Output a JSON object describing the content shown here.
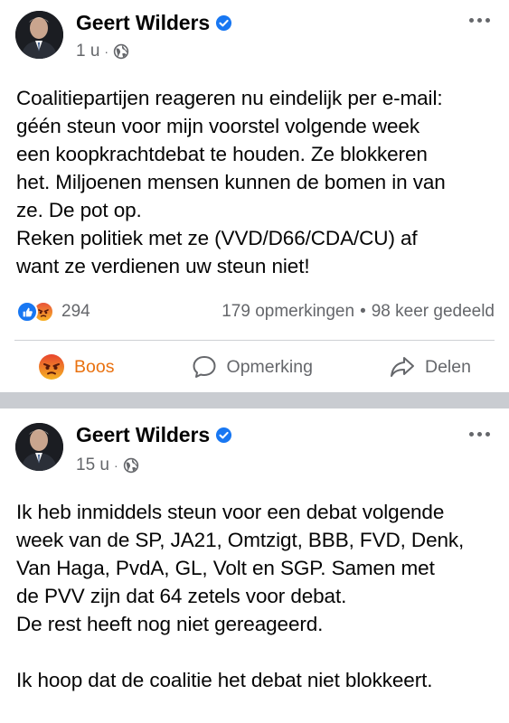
{
  "posts": [
    {
      "author": "Geert Wilders",
      "time": "1 u",
      "text_lines": [
        "Coalitiepartijen reageren nu eindelijk per e-mail:",
        "géén steun voor mijn voorstel volgende week",
        "een koopkrachtdebat te houden. Ze blokkeren",
        "het. Miljoenen mensen kunnen de bomen in van",
        "ze. De pot op.",
        "Reken politiek met ze (VVD/D66/CDA/CU) af",
        "want ze verdienen uw steun niet!"
      ],
      "reaction_count": "294",
      "comments": "179 opmerkingen",
      "stats_separator": "•",
      "shares": "98 keer gedeeld",
      "actions": {
        "react_label": "Boos",
        "comment_label": "Opmerking",
        "share_label": "Delen"
      }
    },
    {
      "author": "Geert Wilders",
      "time": "15 u",
      "text_lines": [
        "Ik heb inmiddels steun voor een debat volgende",
        "week van de SP, JA21, Omtzigt, BBB, FVD, Denk,",
        "Van Haga, PvdA, GL, Volt en SGP. Samen met",
        "de PVV zijn dat 64 zetels voor debat.",
        "De rest heeft nog niet gereageerd.",
        "",
        "Ik hoop dat de coalitie het debat niet blokkeert."
      ]
    }
  ],
  "meta_separator": "·",
  "icons": {
    "verified": "verified-badge-icon",
    "privacy": "globe-icon",
    "more": "more-options-icon",
    "like": "like-reaction-icon",
    "angry": "angry-reaction-icon",
    "comment": "comment-bubble-icon",
    "share": "share-arrow-icon"
  },
  "colors": {
    "verified_blue": "#1877f2",
    "secondary_text": "#65676b",
    "angry_orange": "#e9710f",
    "separator_gray": "#c9ccd1"
  }
}
